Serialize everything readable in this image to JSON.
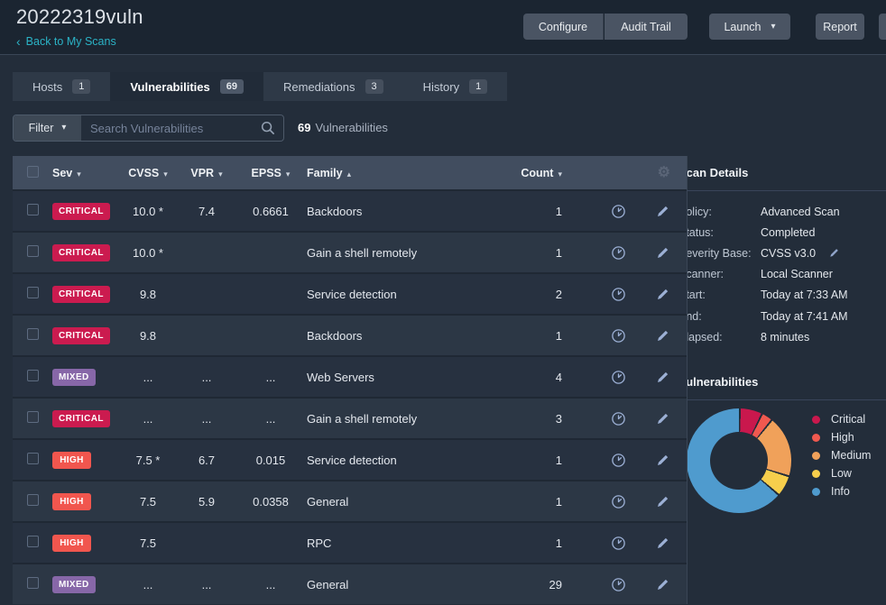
{
  "header": {
    "title": "20222319vuln",
    "back_link": {
      "chevron": "‹",
      "label": "Back to My Scans"
    },
    "buttons": [
      {
        "label": "Configure"
      },
      {
        "label": "Audit Trail"
      },
      {
        "label": "Launch"
      },
      {
        "label": "Report"
      }
    ]
  },
  "tabs": [
    {
      "label": "Hosts",
      "count": "1"
    },
    {
      "label": "Vulnerabilities",
      "count": "69"
    },
    {
      "label": "Remediations",
      "count": "3"
    },
    {
      "label": "History",
      "count": "1"
    }
  ],
  "toolbar": {
    "filter_label": "Filter",
    "caret": "▾",
    "search_placeholder": "Search Vulnerabilities",
    "result_count": "69",
    "result_label": "Vulnerabilities"
  },
  "table": {
    "headers": {
      "sev": "Sev",
      "cvss": "CVSS",
      "vpr": "VPR",
      "epss": "EPSS",
      "family": "Family",
      "count": "Count"
    },
    "sort_desc": "▾",
    "sort_asc": "▴",
    "severity_colors": {
      "CRITICAL": "#cb1b4f",
      "HIGH": "#f1564e",
      "MIXED": "#8767a8"
    },
    "rows": [
      {
        "sev": "CRITICAL",
        "cvss": "10.0 *",
        "vpr": "7.4",
        "epss": "0.6661",
        "family": "Backdoors",
        "count": "1"
      },
      {
        "sev": "CRITICAL",
        "cvss": "10.0 *",
        "vpr": "",
        "epss": "",
        "family": "Gain a shell remotely",
        "count": "1"
      },
      {
        "sev": "CRITICAL",
        "cvss": "9.8",
        "vpr": "",
        "epss": "",
        "family": "Service detection",
        "count": "2"
      },
      {
        "sev": "CRITICAL",
        "cvss": "9.8",
        "vpr": "",
        "epss": "",
        "family": "Backdoors",
        "count": "1"
      },
      {
        "sev": "MIXED",
        "cvss": "...",
        "vpr": "...",
        "epss": "...",
        "family": "Web Servers",
        "count": "4"
      },
      {
        "sev": "CRITICAL",
        "cvss": "...",
        "vpr": "...",
        "epss": "...",
        "family": "Gain a shell remotely",
        "count": "3"
      },
      {
        "sev": "HIGH",
        "cvss": "7.5 *",
        "vpr": "6.7",
        "epss": "0.015",
        "family": "Service detection",
        "count": "1"
      },
      {
        "sev": "HIGH",
        "cvss": "7.5",
        "vpr": "5.9",
        "epss": "0.0358",
        "family": "General",
        "count": "1"
      },
      {
        "sev": "HIGH",
        "cvss": "7.5",
        "vpr": "",
        "epss": "",
        "family": "RPC",
        "count": "1"
      },
      {
        "sev": "MIXED",
        "cvss": "...",
        "vpr": "...",
        "epss": "...",
        "family": "General",
        "count": "29"
      }
    ]
  },
  "scan_details": {
    "title": "Scan Details",
    "rows": [
      {
        "label": "Policy:",
        "value": "Advanced Scan"
      },
      {
        "label": "Status:",
        "value": "Completed"
      },
      {
        "label": "Severity Base:",
        "value": "CVSS v3.0"
      },
      {
        "label": "Scanner:",
        "value": "Local Scanner"
      },
      {
        "label": "Start:",
        "value": "Today at 7:33 AM"
      },
      {
        "label": "End:",
        "value": "Today at 7:41 AM"
      },
      {
        "label": "Elapsed:",
        "value": "8 minutes"
      }
    ]
  },
  "vulns_panel": {
    "title": "Vulnerabilities",
    "chart_data": {
      "type": "pie",
      "donut": true,
      "labels": [
        "Critical",
        "High",
        "Medium",
        "Low",
        "Info"
      ],
      "values": [
        7,
        3.5,
        19,
        6.5,
        64
      ],
      "unit": "percent",
      "colors": [
        "#c9184d",
        "#f0594f",
        "#f0a15a",
        "#f6ce4c",
        "#4f9bce"
      ],
      "legend_position": "right"
    },
    "legend": [
      {
        "label": "Critical",
        "color": "#c9184d"
      },
      {
        "label": "High",
        "color": "#f0594f"
      },
      {
        "label": "Medium",
        "color": "#f0a15a"
      },
      {
        "label": "Low",
        "color": "#f6ce4c"
      },
      {
        "label": "Info",
        "color": "#4f9bce"
      }
    ]
  }
}
